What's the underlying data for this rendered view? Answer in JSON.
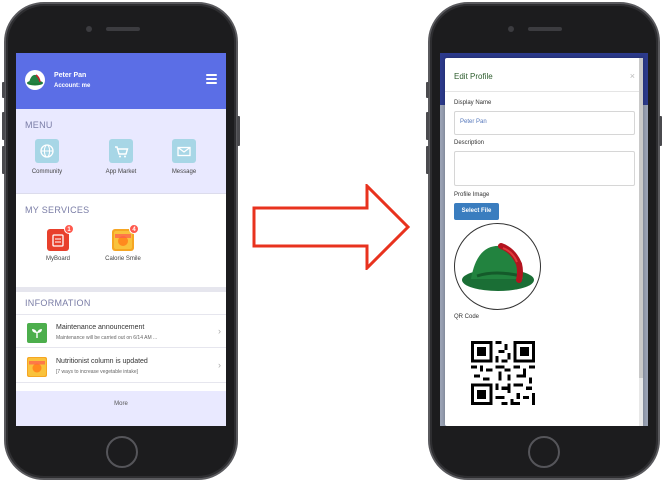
{
  "left_phone": {
    "header": {
      "user_name": "Peter Pan",
      "account": "Account: me",
      "brand_color": "#5b6ee6"
    },
    "menu": {
      "title": "MENU",
      "items": [
        {
          "label": "Community",
          "icon": "globe-icon"
        },
        {
          "label": "App Market",
          "icon": "cart-icon"
        },
        {
          "label": "Message",
          "icon": "envelope-icon"
        }
      ]
    },
    "services": {
      "title": "MY SERVICES",
      "items": [
        {
          "label": "MyBoard",
          "badge": "1",
          "icon": "board-icon"
        },
        {
          "label": "Calorie Smile",
          "badge": "4",
          "icon": "calorie-icon"
        }
      ]
    },
    "information": {
      "title": "INFORMATION",
      "items": [
        {
          "title": "Maintenance announcement",
          "subtitle": "Maintenance will be carried out on 6/14 AM ...",
          "icon": "sprout-icon"
        },
        {
          "title": "Nutritionist column is updated",
          "subtitle": "[7 ways to increase vegetable intake]",
          "icon": "calorie-icon"
        }
      ]
    },
    "more_label": "More"
  },
  "right_phone": {
    "modal": {
      "title": "Edit Profile",
      "close": "×",
      "display_name_label": "Display Name",
      "display_name_value": "Peter Pan",
      "description_label": "Description",
      "description_value": "",
      "profile_image_label": "Profile Image",
      "select_file_label": "Select File",
      "qr_label": "QR Code"
    }
  },
  "colors": {
    "arrow": "#e8321e",
    "select_button": "#3a7dbf",
    "badge": "#ff5a4e"
  }
}
